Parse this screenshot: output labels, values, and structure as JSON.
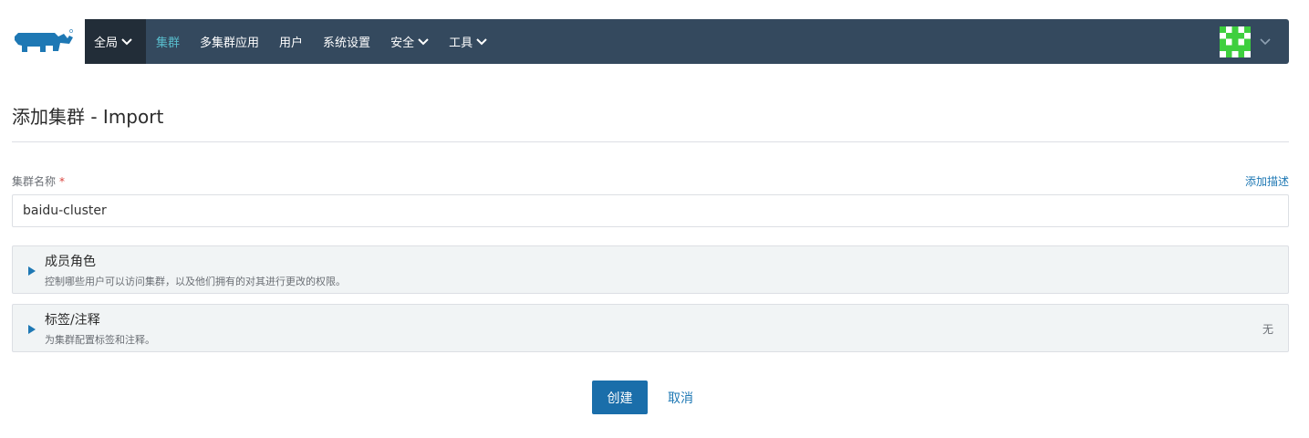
{
  "nav": {
    "global_label": "全局",
    "items": [
      "集群",
      "多集群应用",
      "用户",
      "系统设置",
      "安全",
      "工具"
    ],
    "active_index": 0,
    "accent_color": "#58bccc",
    "bar_color": "#34495e"
  },
  "page": {
    "title": "添加集群 - Import"
  },
  "form": {
    "cluster_name_label": "集群名称",
    "required_mark": "*",
    "add_description_link": "添加描述",
    "cluster_name_value": "baidu-cluster"
  },
  "sections": [
    {
      "title": "成员角色",
      "description": "控制哪些用户可以访问集群，以及他们拥有的对其进行更改的权限。",
      "status": ""
    },
    {
      "title": "标签/注释",
      "description": "为集群配置标签和注释。",
      "status": "无"
    }
  ],
  "actions": {
    "create_label": "创建",
    "cancel_label": "取消",
    "primary_color": "#1a6eaa"
  },
  "icons": {
    "logo": "rancher-logo",
    "user_avatar": "identicon-avatar",
    "expand": "triangle-right-icon",
    "dropdown": "chevron-down-icon"
  }
}
